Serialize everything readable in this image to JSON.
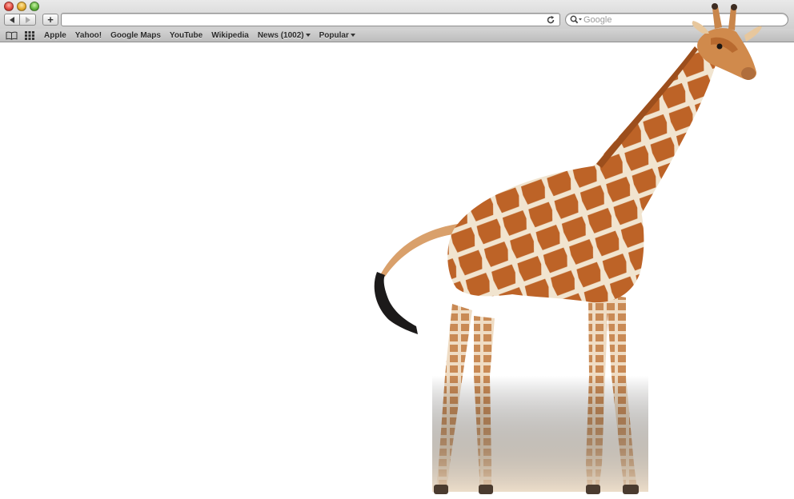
{
  "window": {
    "traffic_lights": [
      "close",
      "minimize",
      "zoom"
    ]
  },
  "toolbar": {
    "back_icon": "back-arrow-icon",
    "forward_icon": "forward-arrow-icon",
    "add_label": "+",
    "address_value": "",
    "reload_icon": "reload-icon",
    "search_placeholder": "Google"
  },
  "bookmarks": {
    "reading_list_icon": "book-icon",
    "top_sites_icon": "grid-icon",
    "items": [
      {
        "label": "Apple",
        "menu": false
      },
      {
        "label": "Yahoo!",
        "menu": false
      },
      {
        "label": "Google Maps",
        "menu": false
      },
      {
        "label": "YouTube",
        "menu": false
      },
      {
        "label": "Wikipedia",
        "menu": false
      },
      {
        "label": "News (1002)",
        "menu": true
      },
      {
        "label": "Popular",
        "menu": true
      }
    ]
  },
  "content": {
    "image": "giraffe-photo",
    "colors": {
      "giraffe_fur": "#c26a2c",
      "giraffe_pattern_lines": "#f4e8d6",
      "tail_tuft": "#1c1a1a",
      "background": "#ffffff"
    }
  }
}
